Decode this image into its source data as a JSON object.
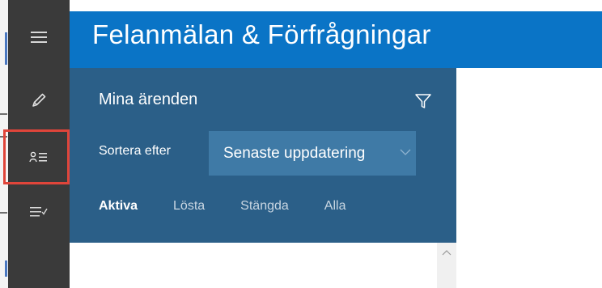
{
  "app": {
    "title": "Felanmälan & Förfrågningar"
  },
  "nav": {
    "items": [
      {
        "name": "menu",
        "icon": "hamburger-menu-icon"
      },
      {
        "name": "new-report",
        "icon": "pencil-icon"
      },
      {
        "name": "my-cases",
        "icon": "person-list-icon",
        "highlighted": true
      },
      {
        "name": "checklist",
        "icon": "checklist-icon"
      }
    ],
    "highlight_color": "#e0453a"
  },
  "panel": {
    "title": "Mina ärenden",
    "filter_icon": "funnel-filter-icon",
    "sort_label": "Sortera efter",
    "sort_value": "Senaste uppdatering",
    "tabs": [
      {
        "label": "Aktiva",
        "active": true
      },
      {
        "label": "Lösta",
        "active": false
      },
      {
        "label": "Stängda",
        "active": false
      },
      {
        "label": "Alla",
        "active": false
      }
    ]
  },
  "colors": {
    "nav_bg": "#3a3a3a",
    "banner_bg": "#0a74c6",
    "panel_bg": "#2b5f88",
    "select_bg": "#3f7aa6"
  }
}
